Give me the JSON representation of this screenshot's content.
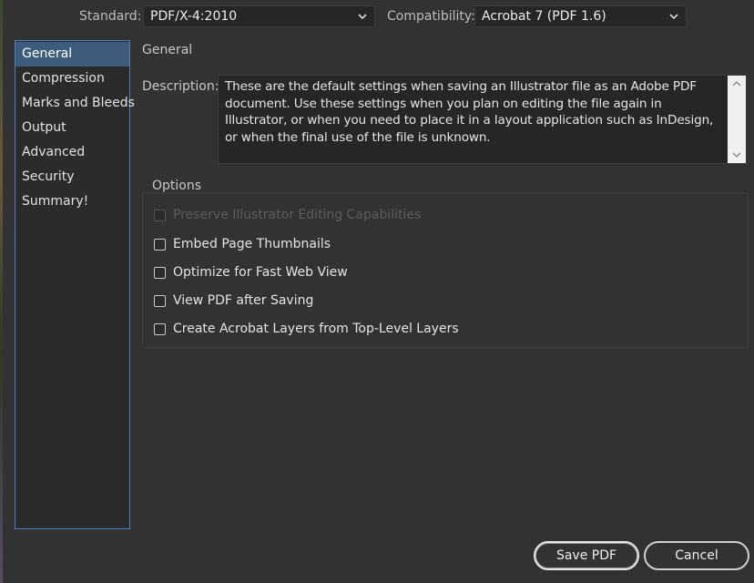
{
  "header": {
    "standard_label": "Standard:",
    "standard_value": "PDF/X-4:2010",
    "compatibility_label": "Compatibility:",
    "compatibility_value": "Acrobat 7 (PDF 1.6)"
  },
  "sidebar": {
    "items": [
      {
        "label": "General",
        "selected": true
      },
      {
        "label": "Compression",
        "selected": false
      },
      {
        "label": "Marks and Bleeds",
        "selected": false
      },
      {
        "label": "Output",
        "selected": false
      },
      {
        "label": "Advanced",
        "selected": false
      },
      {
        "label": "Security",
        "selected": false
      },
      {
        "label": "Summary!",
        "selected": false
      }
    ]
  },
  "main": {
    "section_title": "General",
    "description_label": "Description:",
    "description_text": "These are the default settings when saving an Illustrator file as an Adobe PDF document. Use these settings when you plan on editing the file again in Illustrator, or when you need to place it in a layout application such as InDesign, or when the final use of the file is unknown.",
    "options_legend": "Options",
    "options": [
      {
        "label": "Preserve Illustrator Editing Capabilities",
        "checked": false,
        "disabled": true
      },
      {
        "label": "Embed Page Thumbnails",
        "checked": false,
        "disabled": false
      },
      {
        "label": "Optimize for Fast Web View",
        "checked": false,
        "disabled": false
      },
      {
        "label": "View PDF after Saving",
        "checked": false,
        "disabled": false
      },
      {
        "label": "Create Acrobat Layers from Top-Level Layers",
        "checked": false,
        "disabled": false
      }
    ]
  },
  "footer": {
    "save_label": "Save PDF",
    "cancel_label": "Cancel"
  },
  "colors": {
    "background": "#323232",
    "selection": "#3e5d7d",
    "sidebar_border": "#4a82b8"
  }
}
